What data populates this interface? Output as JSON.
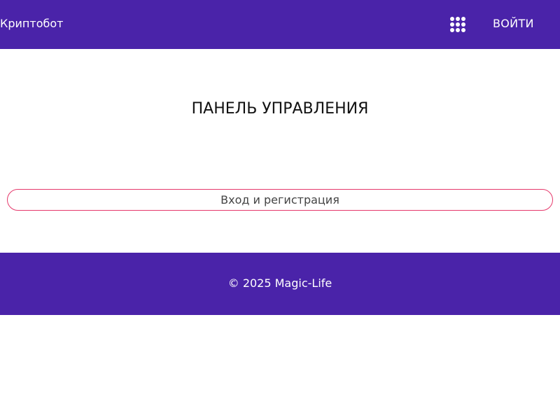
{
  "header": {
    "brand": "Криптобот",
    "apps_icon": "grid-dots-icon",
    "login_label": "ВОЙТИ"
  },
  "main": {
    "title": "ПАНЕЛЬ УПРАВЛЕНИЯ",
    "auth_button_label": "Вход и регистрация"
  },
  "footer": {
    "copyright": "© 2025 Magic-Life"
  },
  "colors": {
    "primary": "#4a23a9",
    "accent_border": "#e5386b",
    "background": "#ffffff"
  }
}
